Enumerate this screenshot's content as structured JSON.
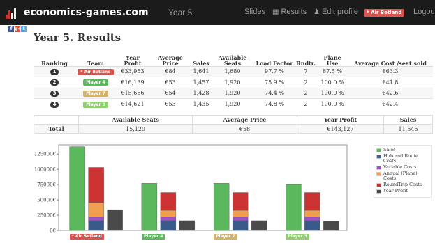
{
  "navbar": {
    "brand": "economics-games.com",
    "center_title": "Year 5",
    "links": [
      {
        "label": "Slides",
        "icon": ""
      },
      {
        "label": "Results",
        "icon": "chart-icon"
      },
      {
        "label": "Edit profile",
        "icon": "user-icon"
      },
      {
        "label": "Logout",
        "icon": ""
      }
    ],
    "user_badge": "* Air Betland",
    "user_badge_color": "#d9534f"
  },
  "social": [
    "f",
    "g+",
    "t"
  ],
  "page": {
    "title": "Year 5. Results"
  },
  "results_table": {
    "headers": [
      "Ranking",
      "Team",
      "Year Profit",
      "Average Price",
      "Sales",
      "Available Seats",
      "Load Factor",
      "Rndtr.",
      "Plane Use",
      "Average Cost /seat sold"
    ],
    "rows": [
      {
        "rank": "1",
        "team": "* Air Betland",
        "team_color": "#d9534f",
        "profit": "€33,953",
        "price": "€84",
        "sales": "1,641",
        "seats": "1,680",
        "load": "97.7 %",
        "rndtr": "7",
        "plane_use": "87.5 %",
        "cost": "€63.3"
      },
      {
        "rank": "2",
        "team": "Player 4",
        "team_color": "#5cb85c",
        "profit": "€16,139",
        "price": "€53",
        "sales": "1,457",
        "seats": "1,920",
        "load": "75.9 %",
        "rndtr": "2",
        "plane_use": "100.0 %",
        "cost": "€41.8"
      },
      {
        "rank": "3",
        "team": "Player 7",
        "team_color": "#d4b26a",
        "profit": "€15,656",
        "price": "€54",
        "sales": "1,428",
        "seats": "1,920",
        "load": "74.4 %",
        "rndtr": "2",
        "plane_use": "100.0 %",
        "cost": "€42.6"
      },
      {
        "rank": "4",
        "team": "Player 3",
        "team_color": "#8fcf6f",
        "profit": "€14,621",
        "price": "€53",
        "sales": "1,435",
        "seats": "1,920",
        "load": "74.8 %",
        "rndtr": "2",
        "plane_use": "100.0 %",
        "cost": "€42.4"
      }
    ]
  },
  "totals_table": {
    "headers": [
      "",
      "Available Seats",
      "Average Price",
      "Year Profit",
      "Sales"
    ],
    "row": {
      "label": "Total",
      "seats": "15,120",
      "price": "€58",
      "profit": "€143,127",
      "sales": "11,546"
    }
  },
  "chart_data": {
    "type": "bar",
    "categories": [
      "* Air Betland",
      "Player 4",
      "Player 7",
      "Player 3"
    ],
    "category_colors": [
      "#d9534f",
      "#5cb85c",
      "#d4b26a",
      "#8fcf6f"
    ],
    "ylim": [
      0,
      140000
    ],
    "yticks": [
      "0€",
      "25000€",
      "50000€",
      "75000€",
      "100000€",
      "125000€"
    ],
    "ytick_values": [
      0,
      25000,
      50000,
      75000,
      100000,
      125000
    ],
    "series": [
      {
        "name": "Sales",
        "color": "#5cb85c",
        "stack": "sales",
        "values": [
          137000,
          77000,
          77000,
          76000
        ]
      },
      {
        "name": "Hub and Route Costs",
        "color": "#3a5a8c",
        "stack": "costs",
        "values": [
          16000,
          16000,
          16000,
          16000
        ]
      },
      {
        "name": "Variable Costs",
        "color": "#9b4fc7",
        "stack": "costs",
        "values": [
          6000,
          6000,
          6000,
          6000
        ]
      },
      {
        "name": "Annual (Plane) Costs",
        "color": "#f0a050",
        "stack": "costs",
        "values": [
          24000,
          11000,
          11000,
          11000
        ]
      },
      {
        "name": "RoundTrip Costs",
        "color": "#cc3333",
        "stack": "costs",
        "values": [
          57000,
          29000,
          29000,
          29000
        ]
      },
      {
        "name": "Year Profit",
        "color": "#4a4a4a",
        "stack": "profit",
        "values": [
          34000,
          16000,
          16000,
          15000
        ]
      }
    ]
  }
}
